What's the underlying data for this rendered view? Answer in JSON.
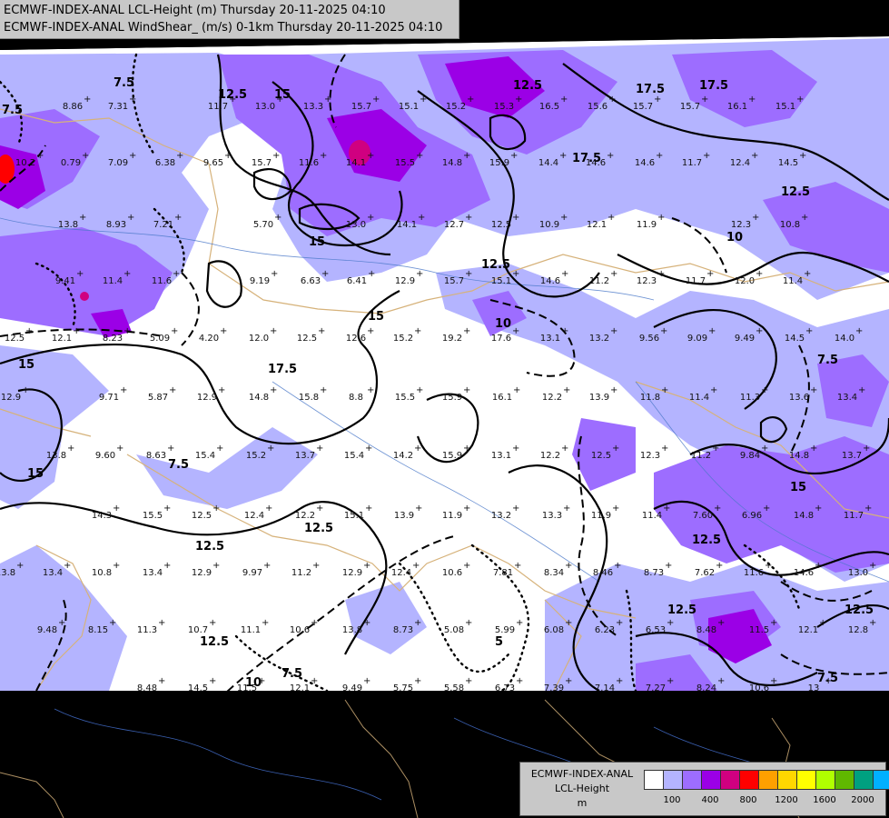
{
  "title": {
    "line1": "ECMWF-INDEX-ANAL LCL-Height (m) Thursday 20-11-2025 04:10",
    "line2": "ECMWF-INDEX-ANAL WindShear_ (m/s) 0-1km Thursday 20-11-2025 04:10"
  },
  "legend": {
    "model": "ECMWF-INDEX-ANAL",
    "field": "LCL-Height",
    "unit": "m",
    "colors": [
      "#ffffff",
      "#b4b4ff",
      "#9d6dff",
      "#9b00e6",
      "#d00080",
      "#ff0000",
      "#ffa000",
      "#ffd700",
      "#ffff00",
      "#b0ff00",
      "#60b800",
      "#00a080",
      "#00b0ff"
    ],
    "ticks": [
      "100",
      "400",
      "800",
      "1200",
      "1600",
      "2000"
    ]
  },
  "contour_labels": [
    "15",
    "12.5",
    "17.5",
    "10",
    "7.5",
    "5"
  ],
  "station_values": [
    "8.86",
    "7.31",
    "11.7",
    "13.0",
    "13.3",
    "15.7",
    "15.1",
    "15.2",
    "15.3",
    "16.5",
    "15.6",
    "15.7",
    "15.7",
    "16.1",
    "15.1",
    "10.2",
    "0.79",
    "7.09",
    "6.38",
    "9.65",
    "15.7",
    "11.6",
    "14.1",
    "15.5",
    "14.8",
    "15.9",
    "14.4",
    "14.6",
    "14.6",
    "11.7",
    "12.4",
    "14.5",
    "13.8",
    "8.93",
    "7.21",
    "5.70",
    "13.0",
    "14.1",
    "12.7",
    "12.5",
    "10.9",
    "12.1",
    "11.9",
    "12.3",
    "10.8",
    "9.41",
    "11.4",
    "11.6",
    "9.19",
    "6.63",
    "6.41",
    "12.9",
    "15.7",
    "15.1",
    "14.6",
    "11.2",
    "12.3",
    "11.7",
    "12.0",
    "11.4",
    "12.5",
    "12.1",
    "8.23",
    "5.09",
    "4.20",
    "12.0",
    "12.5",
    "12.6",
    "15.2",
    "19.2",
    "17.6",
    "13.1",
    "13.2",
    "9.56",
    "9.09",
    "9.49",
    "14.5",
    "14.0",
    "12.9",
    "9.71",
    "5.87",
    "12.9",
    "14.8",
    "15.8",
    "8.8",
    "15.5",
    "15.9",
    "16.1",
    "12.2",
    "13.9",
    "11.8",
    "11.4",
    "11.3",
    "13.6",
    "13.4",
    "13.8",
    "9.60",
    "8.63",
    "15.4",
    "15.2",
    "13.7",
    "15.4",
    "14.2",
    "15.9",
    "13.1",
    "12.2",
    "12.5",
    "12.3",
    "11.2",
    "9.84",
    "14.8",
    "13.7",
    "14.3",
    "15.5",
    "12.5",
    "12.4",
    "12.2",
    "15.1",
    "13.9",
    "11.9",
    "13.2",
    "13.3",
    "11.9",
    "11.4",
    "7.60",
    "6.96",
    "14.8",
    "11.7",
    "13.8",
    "13.4",
    "10.8",
    "13.4",
    "12.9",
    "9.97",
    "11.2",
    "12.9",
    "12.4",
    "10.6",
    "7.81",
    "8.34",
    "8.46",
    "8.73",
    "7.62",
    "11.6",
    "14.6",
    "13.0",
    "9.48",
    "8.15",
    "11.3",
    "10.7",
    "11.1",
    "10.6",
    "13.8",
    "8.73",
    "5.08",
    "5.99",
    "6.08",
    "6.23",
    "6.53",
    "8.48",
    "11.5",
    "12.1",
    "12.8",
    "8.48",
    "14.5",
    "11.5",
    "12.1",
    "9.49",
    "5.75",
    "5.58",
    "6.73",
    "7.39",
    "7.14",
    "7.27",
    "8.24",
    "10.6",
    "13",
    "12.8",
    "5.75"
  ]
}
